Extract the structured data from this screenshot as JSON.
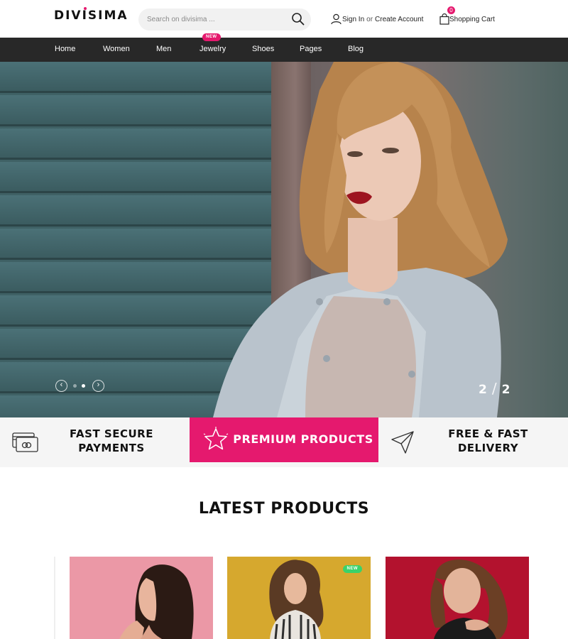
{
  "header": {
    "logo": "DIVISIMA",
    "search_placeholder": "Search on divisima ...",
    "account_sign_in": "Sign In",
    "account_or": "or",
    "account_create": "Create Account",
    "cart_label": "Shopping Cart",
    "cart_count": "0"
  },
  "nav": {
    "items": [
      {
        "label": "Home"
      },
      {
        "label": "Women"
      },
      {
        "label": "Men"
      },
      {
        "label": "Jewelry",
        "tag": "NEW"
      },
      {
        "label": "Shoes"
      },
      {
        "label": "Pages"
      },
      {
        "label": "Blog"
      }
    ]
  },
  "hero": {
    "slide_current": "2",
    "slide_total": "2",
    "active_dot": 2,
    "dot_count": 2
  },
  "features": [
    {
      "line1": "FAST SECURE",
      "line2": "PAYMENTS",
      "icon": "credit-card-icon"
    },
    {
      "line1": "PREMIUM PRODUCTS",
      "icon": "star-icon"
    },
    {
      "line1": "FREE & FAST",
      "line2": "DELIVERY",
      "icon": "paper-plane-icon"
    }
  ],
  "latest": {
    "title": "LATEST PRODUCTS",
    "products": [
      {
        "badge": ""
      },
      {
        "badge": "NEW"
      },
      {
        "badge": ""
      }
    ]
  },
  "colors": {
    "accent": "#e5196e",
    "nav_bg": "#282828",
    "new_badge_green": "#3ad26a"
  }
}
